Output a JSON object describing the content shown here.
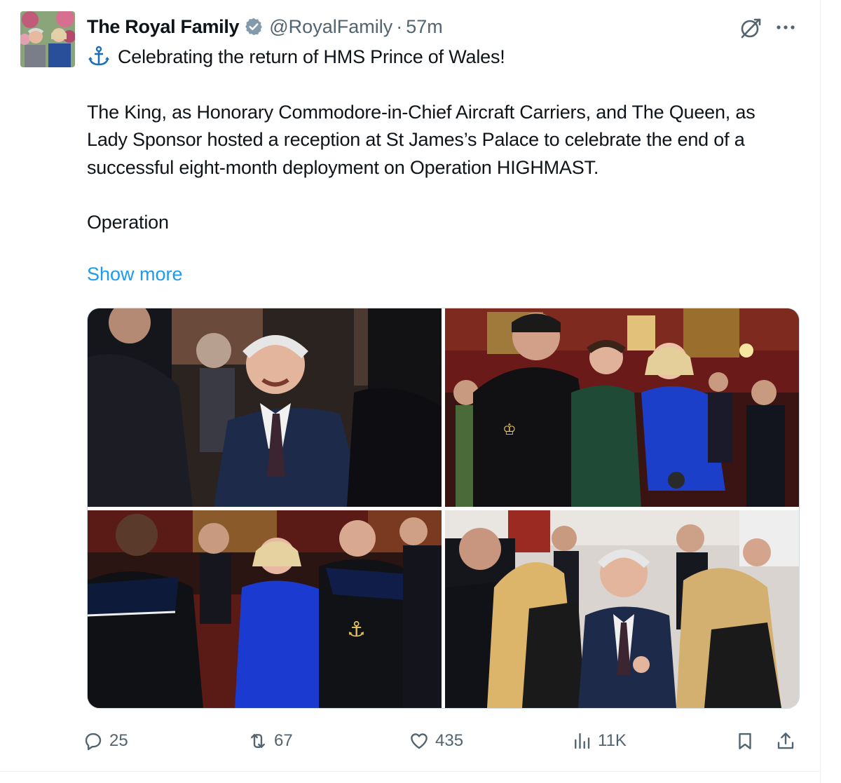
{
  "tweet": {
    "author": {
      "display_name": "The Royal Family",
      "handle": "@RoyalFamily",
      "time": "57m",
      "verified": true,
      "avatar_icon": "avatar-photo"
    },
    "header_icons": {
      "grok": "grok-icon",
      "more": "more-icon"
    },
    "text": {
      "line1": "Celebrating the return of HMS Prince of Wales!",
      "line1_icon": "anchor-icon",
      "para2": "The King, as Honorary Commodore-in-Chief Aircraft Carriers, and The Queen, as Lady Sponsor hosted a reception at St James’s Palace to celebrate the end of a successful eight-month deployment on Operation HIGHMAST.",
      "para3": "Operation"
    },
    "show_more": "Show more",
    "media": {
      "count": 4
    },
    "actions": {
      "replies": "25",
      "reposts": "67",
      "likes": "435",
      "views": "11K",
      "bookmark_icon": "bookmark-icon",
      "share_icon": "share-icon"
    }
  },
  "colors": {
    "text_primary": "#0f1419",
    "text_secondary": "#536471",
    "link": "#1d9bf0",
    "border": "#cfd9de",
    "divider": "#eff3f4"
  }
}
